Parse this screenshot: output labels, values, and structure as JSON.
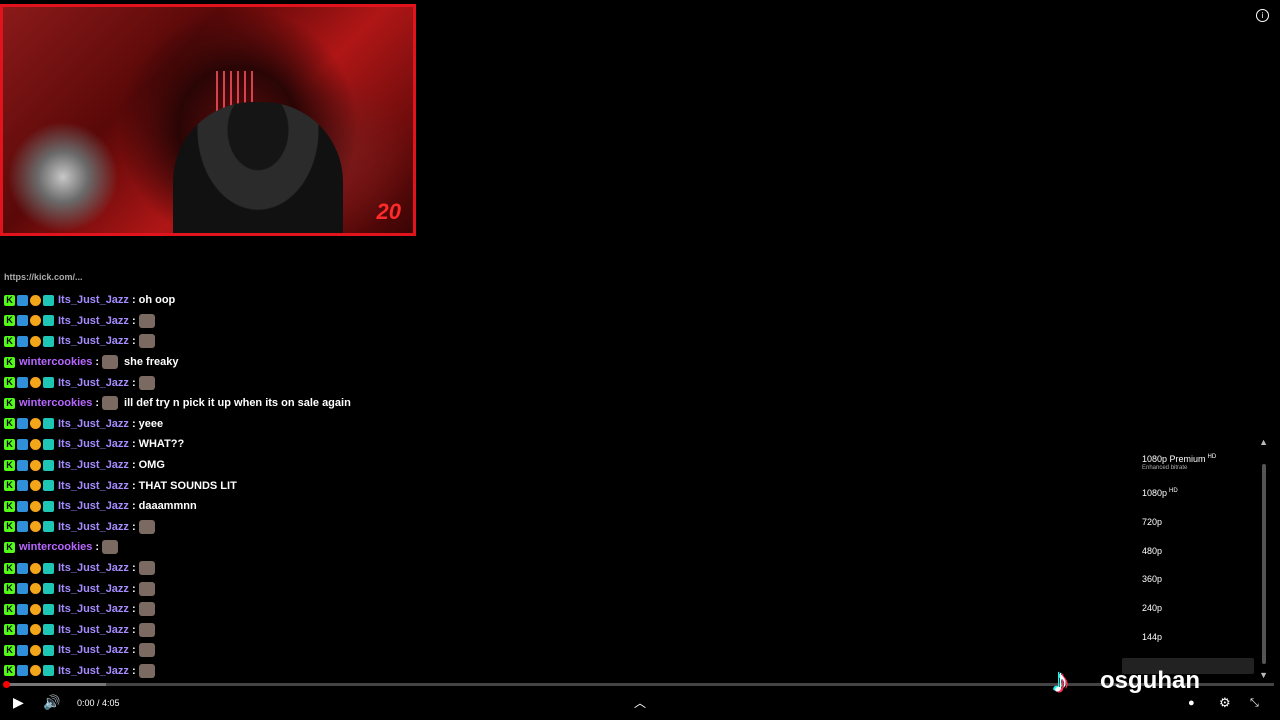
{
  "overlay": {
    "webcam_badge": "20",
    "chat_cut_line": "https://kick.com/..."
  },
  "chat": {
    "messages": [
      {
        "user": "Its_Just_Jazz",
        "text": "oh oop",
        "badges": [
          "kick",
          "sub",
          "one",
          "tier"
        ],
        "user_color": "#a58cff",
        "emote": false
      },
      {
        "user": "Its_Just_Jazz",
        "text": "",
        "badges": [
          "kick",
          "sub",
          "one",
          "tier"
        ],
        "user_color": "#a58cff",
        "emote": true
      },
      {
        "user": "Its_Just_Jazz",
        "text": "",
        "badges": [
          "kick",
          "sub",
          "one",
          "tier"
        ],
        "user_color": "#a58cff",
        "emote": true
      },
      {
        "user": "wintercookies",
        "text": "she freaky",
        "badges": [
          "kick"
        ],
        "user_color": "#b767ff",
        "emote": true
      },
      {
        "user": "Its_Just_Jazz",
        "text": "",
        "badges": [
          "kick",
          "sub",
          "one",
          "tier"
        ],
        "user_color": "#a58cff",
        "emote": true
      },
      {
        "user": "wintercookies",
        "text": "ill def try n pick it up when its on sale again",
        "badges": [
          "kick"
        ],
        "user_color": "#b767ff",
        "emote": true
      },
      {
        "user": "Its_Just_Jazz",
        "text": "yeee",
        "badges": [
          "kick",
          "sub",
          "one",
          "tier"
        ],
        "user_color": "#a58cff",
        "emote": false
      },
      {
        "user": "Its_Just_Jazz",
        "text": "WHAT??",
        "badges": [
          "kick",
          "sub",
          "one",
          "tier"
        ],
        "user_color": "#a58cff",
        "emote": false
      },
      {
        "user": "Its_Just_Jazz",
        "text": "OMG",
        "badges": [
          "kick",
          "sub",
          "one",
          "tier"
        ],
        "user_color": "#a58cff",
        "emote": false
      },
      {
        "user": "Its_Just_Jazz",
        "text": "THAT SOUNDS LIT",
        "badges": [
          "kick",
          "sub",
          "one",
          "tier"
        ],
        "user_color": "#a58cff",
        "emote": false
      },
      {
        "user": "Its_Just_Jazz",
        "text": "daaammnn",
        "badges": [
          "kick",
          "sub",
          "one",
          "tier"
        ],
        "user_color": "#a58cff",
        "emote": false
      },
      {
        "user": "Its_Just_Jazz",
        "text": "",
        "badges": [
          "kick",
          "sub",
          "one",
          "tier"
        ],
        "user_color": "#a58cff",
        "emote": true
      },
      {
        "user": "wintercookies",
        "text": "",
        "badges": [
          "kick"
        ],
        "user_color": "#b767ff",
        "emote": true
      },
      {
        "user": "Its_Just_Jazz",
        "text": "",
        "badges": [
          "kick",
          "sub",
          "one",
          "tier"
        ],
        "user_color": "#a58cff",
        "emote": true
      },
      {
        "user": "Its_Just_Jazz",
        "text": "",
        "badges": [
          "kick",
          "sub",
          "one",
          "tier"
        ],
        "user_color": "#a58cff",
        "emote": true
      },
      {
        "user": "Its_Just_Jazz",
        "text": "",
        "badges": [
          "kick",
          "sub",
          "one",
          "tier"
        ],
        "user_color": "#a58cff",
        "emote": true
      },
      {
        "user": "Its_Just_Jazz",
        "text": "",
        "badges": [
          "kick",
          "sub",
          "one",
          "tier"
        ],
        "user_color": "#a58cff",
        "emote": true
      },
      {
        "user": "Its_Just_Jazz",
        "text": "",
        "badges": [
          "kick",
          "sub",
          "one",
          "tier"
        ],
        "user_color": "#a58cff",
        "emote": true
      },
      {
        "user": "Its_Just_Jazz",
        "text": "",
        "badges": [
          "kick",
          "sub",
          "one",
          "tier"
        ],
        "user_color": "#a58cff",
        "emote": true
      }
    ]
  },
  "quality_menu": {
    "items": [
      {
        "label": "1080p Premium",
        "tag": "HD",
        "sub": "Enhanced bitrate"
      },
      {
        "label": "1080p",
        "tag": "HD",
        "sub": ""
      },
      {
        "label": "720p",
        "tag": "",
        "sub": ""
      },
      {
        "label": "480p",
        "tag": "",
        "sub": ""
      },
      {
        "label": "360p",
        "tag": "",
        "sub": ""
      },
      {
        "label": "240p",
        "tag": "",
        "sub": ""
      },
      {
        "label": "144p",
        "tag": "",
        "sub": ""
      }
    ]
  },
  "player": {
    "time": "0:00 / 4:05",
    "progress_fraction": 0.0,
    "accent_color": "#ff0000"
  },
  "watermark": {
    "name": "osguhan"
  },
  "icons": [
    "play-icon",
    "volume-icon",
    "chevron-up-icon",
    "settings-icon",
    "fullscreen-exit-icon",
    "info-icon",
    "tiktok-logo-icon"
  ]
}
